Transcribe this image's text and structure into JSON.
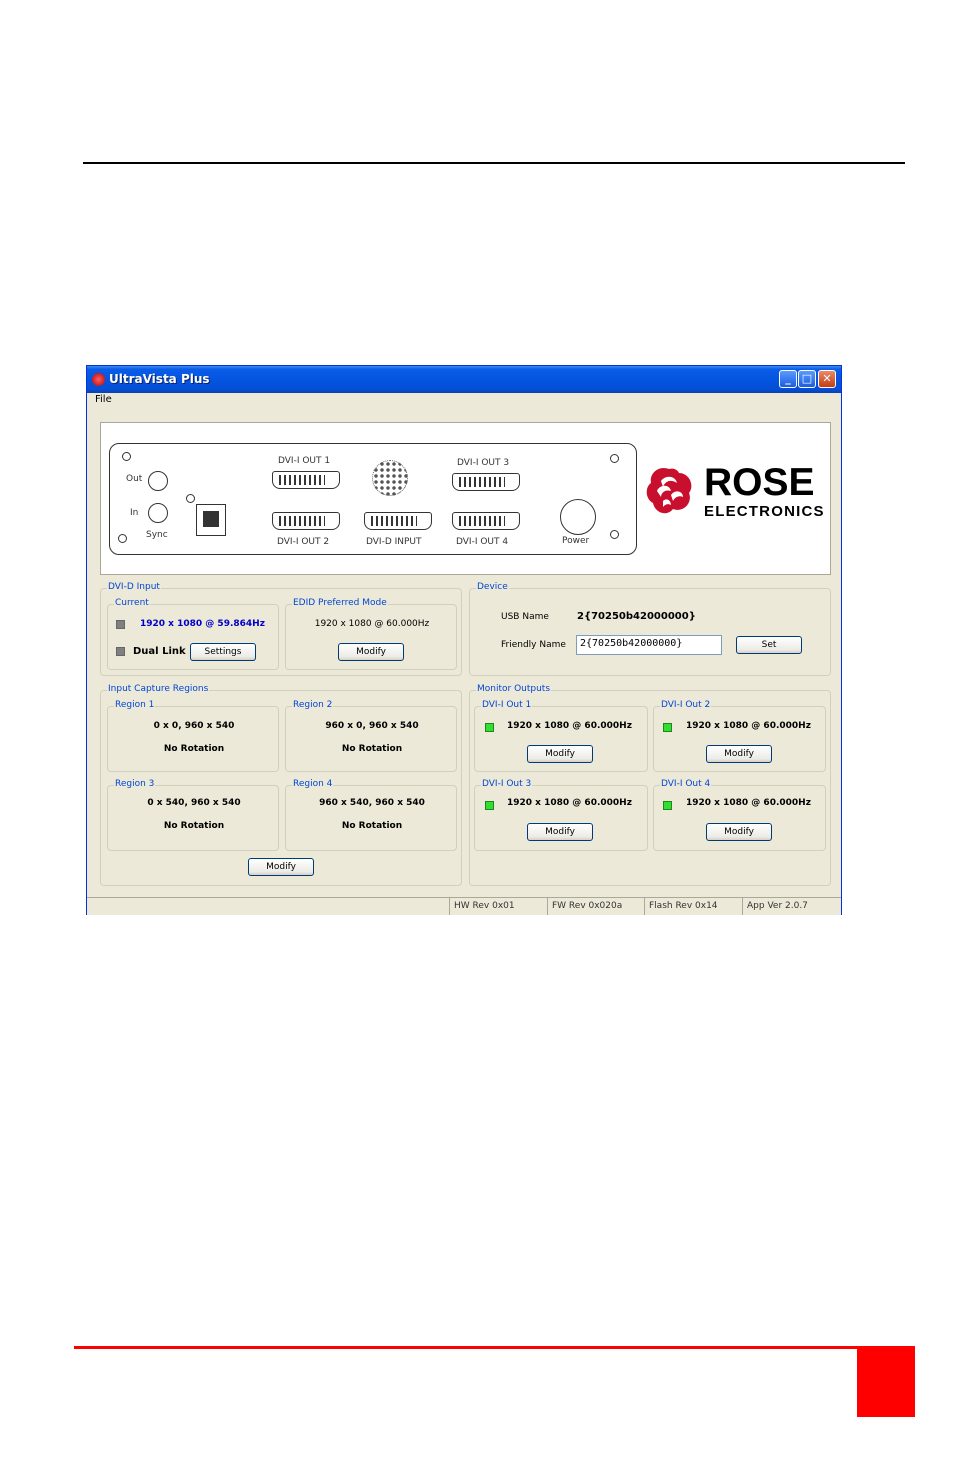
{
  "window": {
    "title": "UltraVista Plus"
  },
  "menu": {
    "file": "File"
  },
  "rear_panel": {
    "out": "Out",
    "in": "In",
    "sync": "Sync",
    "dvi_out_1": "DVI-I OUT 1",
    "dvi_out_2": "DVI-I OUT 2",
    "dvi_out_3": "DVI-I OUT 3",
    "dvi_out_4": "DVI-I OUT 4",
    "dvi_input": "DVI-D INPUT",
    "power": "Power"
  },
  "logo": {
    "line1": "ROSE",
    "line2": "ELECTRONICS"
  },
  "dvi_input": {
    "group": "DVI-D Input",
    "current": {
      "group": "Current",
      "mode": "1920 x 1080 @ 59.864Hz",
      "dual_link": "Dual Link",
      "settings": "Settings"
    },
    "edid": {
      "group": "EDID Preferred Mode",
      "mode": "1920 x 1080 @ 60.000Hz",
      "modify": "Modify"
    }
  },
  "device": {
    "group": "Device",
    "usb_name_label": "USB Name",
    "usb_name": "2{70250b42000000}",
    "friendly_name_label": "Friendly Name",
    "friendly_name": "2{70250b42000000}",
    "set": "Set"
  },
  "capture": {
    "group": "Input Capture Regions",
    "regions": [
      {
        "title": "Region 1",
        "coords": "0 x 0, 960 x 540",
        "rotation": "No Rotation"
      },
      {
        "title": "Region 2",
        "coords": "960 x 0, 960 x 540",
        "rotation": "No Rotation"
      },
      {
        "title": "Region 3",
        "coords": "0 x 540, 960 x 540",
        "rotation": "No Rotation"
      },
      {
        "title": "Region 4",
        "coords": "960 x 540, 960 x 540",
        "rotation": "No Rotation"
      }
    ],
    "modify": "Modify"
  },
  "monitors": {
    "group": "Monitor Outputs",
    "outputs": [
      {
        "title": "DVI-I Out 1",
        "mode": "1920 x 1080 @ 60.000Hz",
        "modify": "Modify"
      },
      {
        "title": "DVI-I Out 2",
        "mode": "1920 x 1080 @ 60.000Hz",
        "modify": "Modify"
      },
      {
        "title": "DVI-I Out 3",
        "mode": "1920 x 1080 @ 60.000Hz",
        "modify": "Modify"
      },
      {
        "title": "DVI-I Out 4",
        "mode": "1920 x 1080 @ 60.000Hz",
        "modify": "Modify"
      }
    ]
  },
  "status": {
    "hw": "HW Rev 0x01",
    "fw": "FW Rev 0x020a",
    "flash": "Flash Rev 0x14",
    "app": "App Ver 2.0.7"
  },
  "colors": {
    "page_accent": "#ff0000",
    "titlebar": "#0454e0",
    "group_title": "#0046d5",
    "led_on": "#33dd33",
    "led_off": "#808080"
  }
}
